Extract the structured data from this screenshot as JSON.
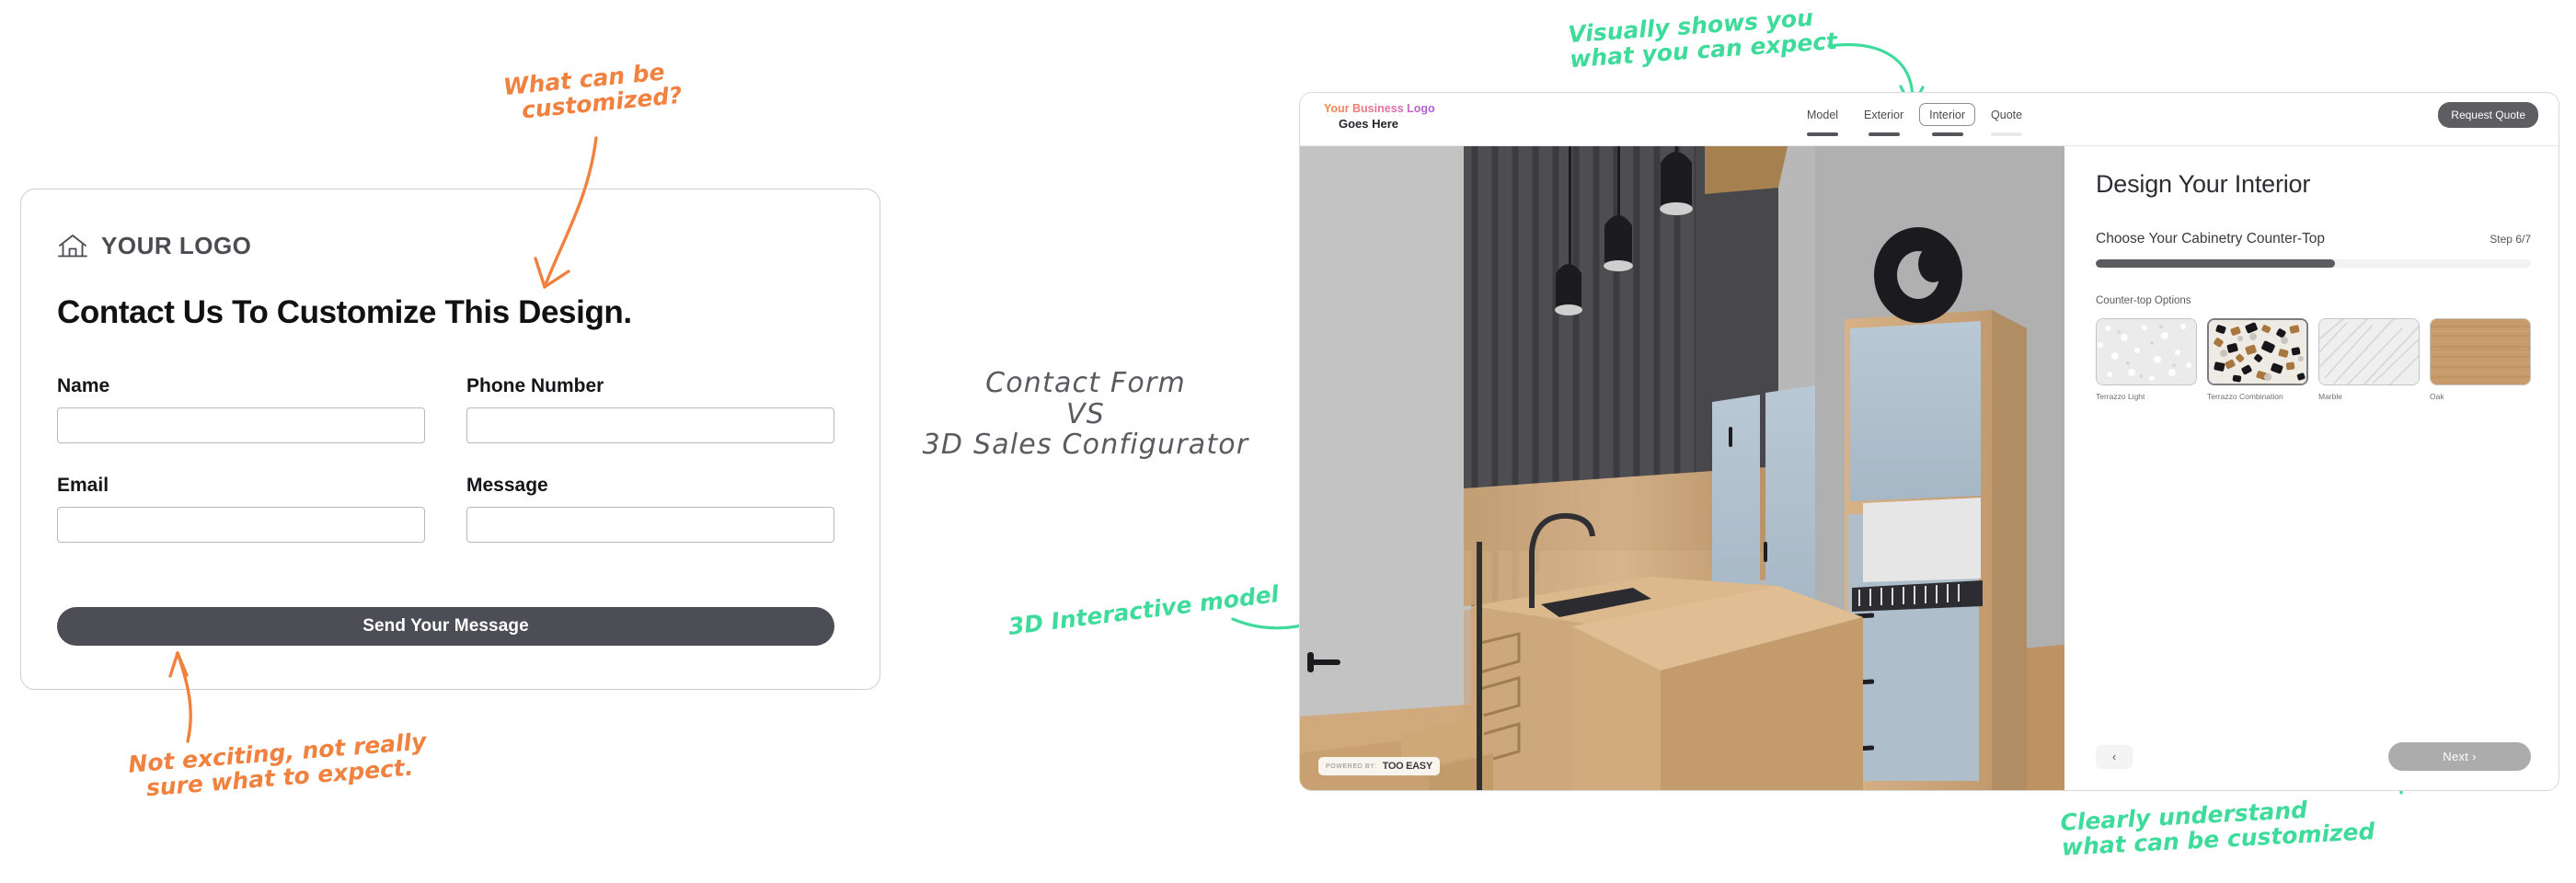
{
  "contact_form": {
    "logo_text": "YOUR LOGO",
    "logo_icon": "house-icon",
    "heading": "Contact Us To Customize This Design.",
    "fields": [
      {
        "label": "Name",
        "value": "",
        "placeholder": ""
      },
      {
        "label": "Phone Number",
        "value": "",
        "placeholder": ""
      },
      {
        "label": "Email",
        "value": "",
        "placeholder": ""
      },
      {
        "label": "Message",
        "value": "",
        "placeholder": ""
      }
    ],
    "submit_label": "Send Your Message",
    "submit_bg": "#4d4d55"
  },
  "center_label": {
    "line1": "Contact Form",
    "line2": "VS",
    "line3": "3D Sales Configurator"
  },
  "annotations": {
    "orange_color": "#f0813f",
    "green_color": "#3fdb9b",
    "what_customized": "What can be\n  customized?",
    "not_exciting": "Not exciting, not really\n  sure what to expect.",
    "visually_shows": "Visually shows you\nwhat you can expect",
    "interactive_model": "3D Interactive model",
    "clearly_understand": "Clearly understand\nwhat can be customized"
  },
  "configurator": {
    "business_logo_line1": "Your Business Logo",
    "business_logo_line2": "Goes Here",
    "tabs": [
      {
        "label": "Model",
        "active": false,
        "bar": "filled"
      },
      {
        "label": "Exterior",
        "active": false,
        "bar": "filled"
      },
      {
        "label": "Interior",
        "active": true,
        "bar": "filled"
      },
      {
        "label": "Quote",
        "active": false,
        "bar": "dim"
      }
    ],
    "request_quote_label": "Request Quote",
    "watermark": {
      "powered_by": "POWERED BY:",
      "brand": "TOO EASY"
    },
    "panel": {
      "title": "Design Your Interior",
      "step_question": "Choose Your Cabinetry Counter-Top",
      "step_counter": "Step  6/7",
      "progress_percent": 55,
      "options_label": "Counter-top Options",
      "swatches": [
        {
          "label": "Terrazzo Light",
          "selected": false,
          "color": "#e9e9e9"
        },
        {
          "label": "Terrazzo Combination",
          "selected": true,
          "color": "#ddd6cc"
        },
        {
          "label": "Marble",
          "selected": false,
          "color": "#ececec"
        },
        {
          "label": "Oak",
          "selected": false,
          "color": "#c79b6a"
        }
      ],
      "back_label": "‹",
      "next_label": "Next  ›"
    }
  }
}
